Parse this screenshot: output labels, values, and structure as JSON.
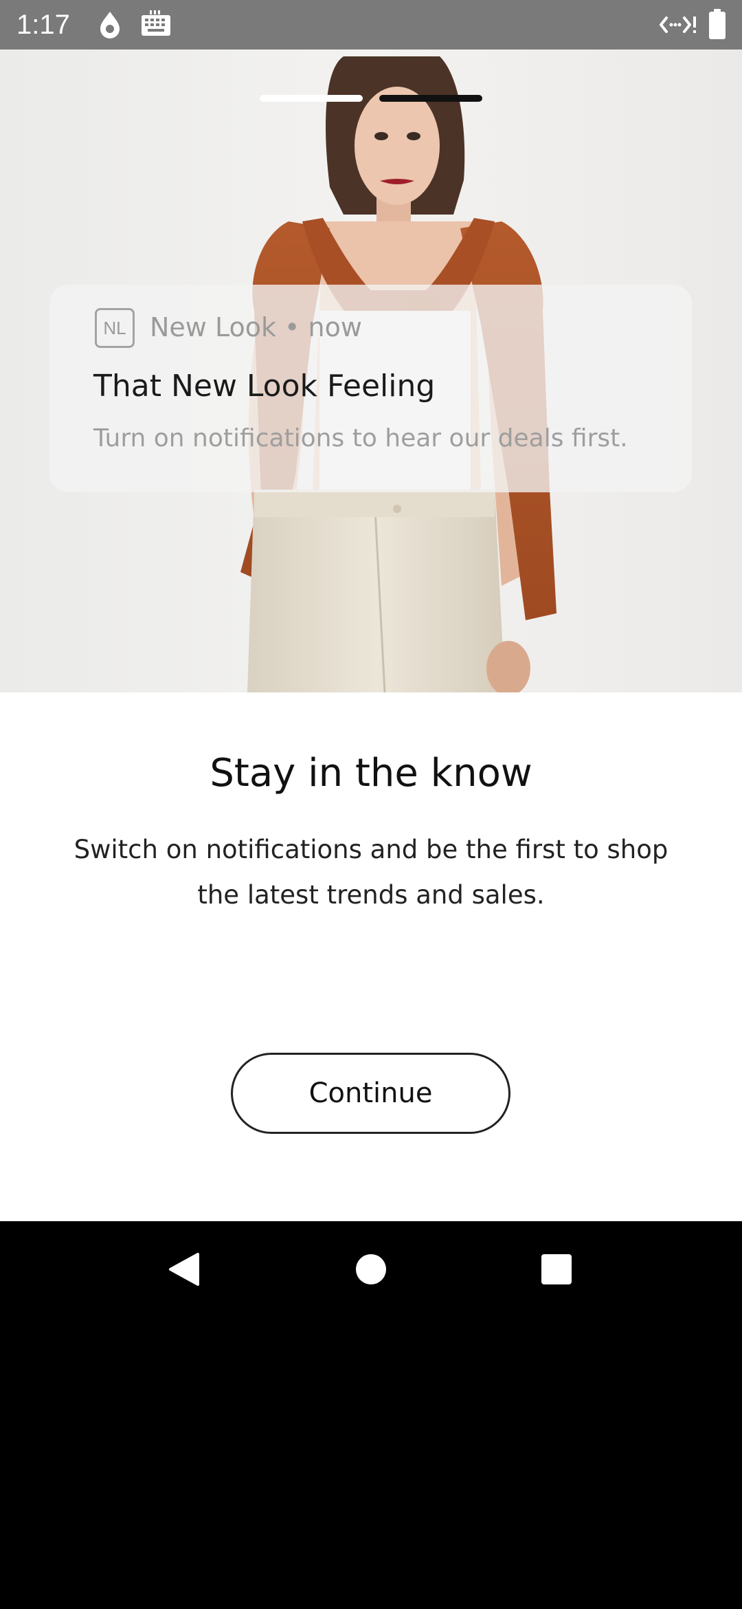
{
  "status_bar": {
    "time": "1:17",
    "icons": [
      "water-drop-icon",
      "keyboard-icon",
      "code-signal-icon",
      "battery-icon"
    ]
  },
  "hero": {
    "pager": [
      {
        "state": "inactive",
        "color": "#ffffff"
      },
      {
        "state": "active",
        "color": "#111111"
      }
    ],
    "notification": {
      "badge": "NL",
      "app_line": "New Look • now",
      "title": "That New Look Feeling",
      "body": "Turn on notifications to hear our deals first."
    }
  },
  "main": {
    "heading": "Stay in the know",
    "subtext": "Switch on notifications and be the first to shop the latest trends and sales.",
    "continue_label": "Continue"
  },
  "nav": {
    "icons": [
      "back-icon",
      "home-icon",
      "recents-icon"
    ]
  },
  "colors": {
    "status_bar": "#7a7a7a",
    "knit_orange": "#b2562a",
    "cream_trousers": "#e7e0d2",
    "text_dark": "#111111"
  }
}
